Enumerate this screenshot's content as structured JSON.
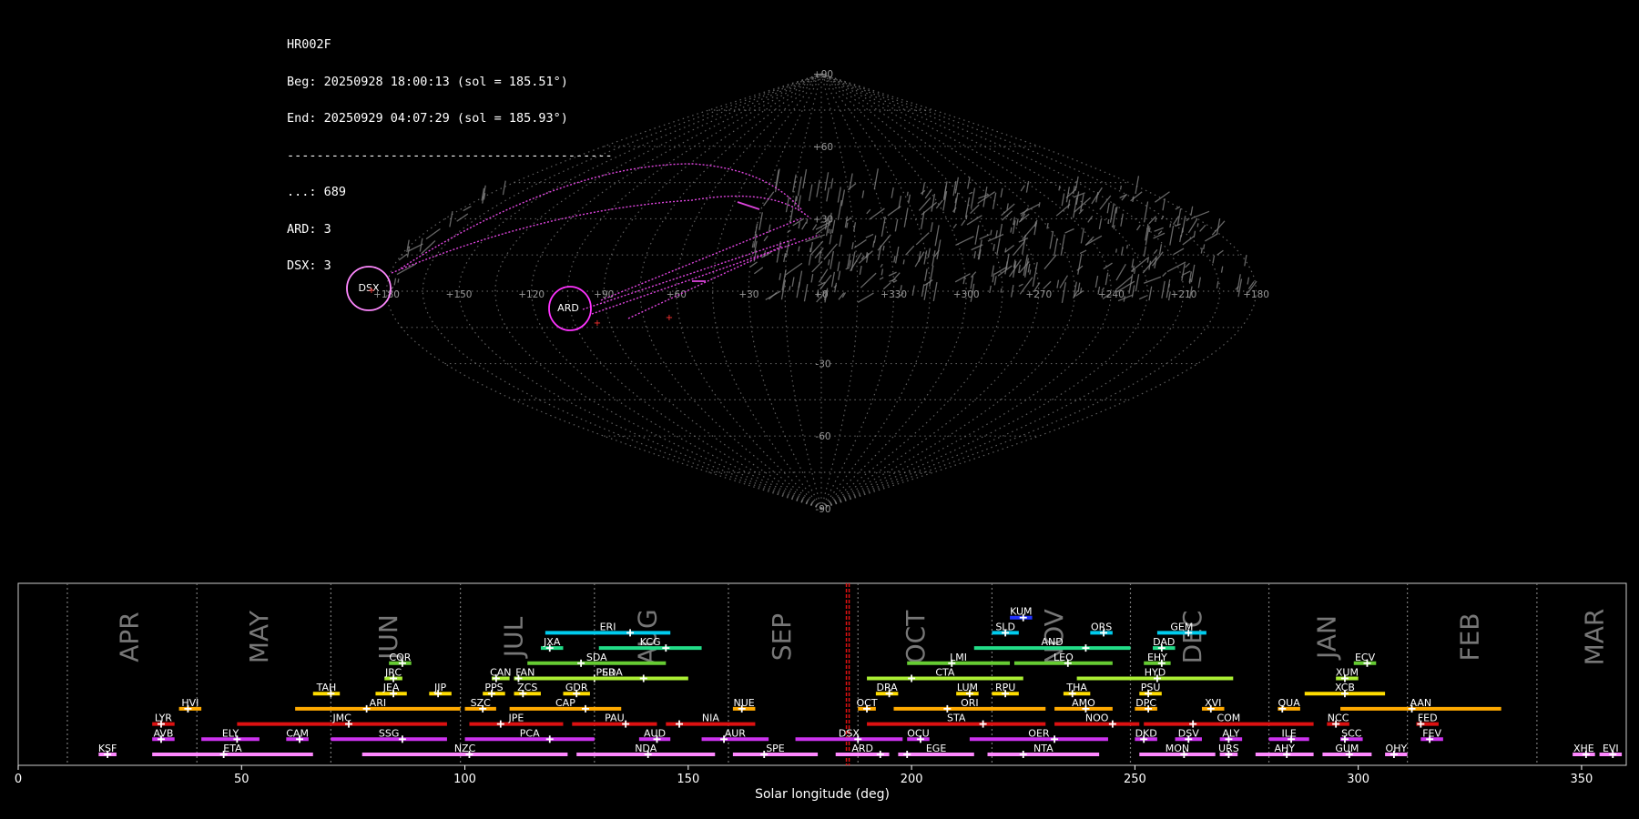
{
  "info": {
    "station": "HR002F",
    "beg": "Beg: 20250928 18:00:13 (sol = 185.51°)",
    "end": "End: 20250929 04:07:29 (sol = 185.93°)",
    "rule": "--------------------------------------------",
    "count_sporadic": "...: 689",
    "count_ard": "ARD: 3",
    "count_dsx": "DSX: 3"
  },
  "sky_map": {
    "projection": "sinusoidal",
    "lon_ticks": [
      "+180",
      "+150",
      "+120",
      "+90",
      "+60",
      "+30",
      "+0",
      "+330",
      "+300",
      "+270",
      "+240",
      "+210",
      "+180"
    ],
    "lat_ticks": [
      "+90",
      "+60",
      "+30",
      "-30",
      "-60",
      "-90"
    ],
    "radiants": [
      {
        "name": "DSX",
        "ring_color": "#ff88ff"
      },
      {
        "name": "ARD",
        "ring_color": "#ff33ff"
      }
    ],
    "colors": {
      "grid": "#888888",
      "sporadic": "#888888",
      "shower_trail": "#dd44dd",
      "marker": "#ff3333"
    }
  },
  "chart_data": {
    "type": "timeline",
    "xlabel": "Solar longitude (deg)",
    "xlim": [
      0,
      360
    ],
    "x_ticks": [
      "0",
      "50",
      "100",
      "150",
      "200",
      "250",
      "300",
      "350"
    ],
    "current_sol": 185.72,
    "current_sol_color": "#dd1111",
    "months": [
      {
        "name": "APR",
        "sol": 25
      },
      {
        "name": "MAY",
        "sol": 54
      },
      {
        "name": "JUN",
        "sol": 83
      },
      {
        "name": "JUL",
        "sol": 111
      },
      {
        "name": "AUG",
        "sol": 141
      },
      {
        "name": "SEP",
        "sol": 171
      },
      {
        "name": "OCT",
        "sol": 201
      },
      {
        "name": "NOV",
        "sol": 232
      },
      {
        "name": "DEC",
        "sol": 263
      },
      {
        "name": "JAN",
        "sol": 293
      },
      {
        "name": "FEB",
        "sol": 325
      },
      {
        "name": "MAR",
        "sol": 353
      }
    ],
    "month_boundaries": [
      11,
      40,
      70,
      99,
      129,
      159,
      188,
      218,
      249,
      280,
      311,
      340
    ],
    "showers": [
      {
        "code": "KSF",
        "start": 18,
        "end": 22,
        "peak": 20,
        "row": 0,
        "color": "#ff88ff"
      },
      {
        "code": "ETA",
        "start": 30,
        "end": 66,
        "peak": 46,
        "row": 0,
        "color": "#ff88ff"
      },
      {
        "code": "NZC",
        "start": 77,
        "end": 123,
        "peak": 101,
        "row": 0,
        "color": "#ff88ff"
      },
      {
        "code": "NDA",
        "start": 125,
        "end": 156,
        "peak": 141,
        "row": 0,
        "color": "#ff88ff"
      },
      {
        "code": "SPE",
        "start": 160,
        "end": 179,
        "peak": 167,
        "row": 0,
        "color": "#ff88ff"
      },
      {
        "code": "ARD",
        "start": 183,
        "end": 195,
        "peak": 193,
        "row": 0,
        "color": "#ff88ff"
      },
      {
        "code": "EGE",
        "start": 197,
        "end": 214,
        "peak": 199,
        "row": 0,
        "color": "#ff88ff"
      },
      {
        "code": "NTA",
        "start": 217,
        "end": 242,
        "peak": 225,
        "row": 0,
        "color": "#ff88ff"
      },
      {
        "code": "MON",
        "start": 251,
        "end": 268,
        "peak": 261,
        "row": 0,
        "color": "#ff88ff"
      },
      {
        "code": "URS",
        "start": 269,
        "end": 273,
        "peak": 271,
        "row": 0,
        "color": "#ff88ff"
      },
      {
        "code": "AHY",
        "start": 277,
        "end": 290,
        "peak": 284,
        "row": 0,
        "color": "#ff88ff"
      },
      {
        "code": "GUM",
        "start": 292,
        "end": 303,
        "peak": 298,
        "row": 0,
        "color": "#ff88ff"
      },
      {
        "code": "OHY",
        "start": 306,
        "end": 311,
        "peak": 308,
        "row": 0,
        "color": "#ff88ff"
      },
      {
        "code": "XHE",
        "start": 348,
        "end": 353,
        "peak": 351,
        "row": 0,
        "color": "#ff88ff"
      },
      {
        "code": "EVI",
        "start": 354,
        "end": 359,
        "peak": 357,
        "row": 0,
        "color": "#ff88ff"
      },
      {
        "code": "AVB",
        "start": 30,
        "end": 35,
        "peak": 32,
        "row": 1,
        "color": "#cc33ee"
      },
      {
        "code": "ELY",
        "start": 41,
        "end": 54,
        "peak": 49,
        "row": 1,
        "color": "#cc33ee"
      },
      {
        "code": "CAM",
        "start": 60,
        "end": 65,
        "peak": 63,
        "row": 1,
        "color": "#cc33ee"
      },
      {
        "code": "SSG",
        "start": 70,
        "end": 96,
        "peak": 86,
        "row": 1,
        "color": "#cc33ee"
      },
      {
        "code": "PCA",
        "start": 100,
        "end": 129,
        "peak": 119,
        "row": 1,
        "color": "#cc33ee"
      },
      {
        "code": "AUD",
        "start": 139,
        "end": 146,
        "peak": 143,
        "row": 1,
        "color": "#cc33ee"
      },
      {
        "code": "AUR",
        "start": 153,
        "end": 168,
        "peak": 158,
        "row": 1,
        "color": "#cc33ee"
      },
      {
        "code": "DSX",
        "start": 174,
        "end": 198,
        "peak": 188,
        "row": 1,
        "color": "#cc33ee"
      },
      {
        "code": "OCU",
        "start": 199,
        "end": 204,
        "peak": 202,
        "row": 1,
        "color": "#cc33ee"
      },
      {
        "code": "OER",
        "start": 213,
        "end": 244,
        "peak": 232,
        "row": 1,
        "color": "#cc33ee"
      },
      {
        "code": "DKD",
        "start": 250,
        "end": 255,
        "peak": 252,
        "row": 1,
        "color": "#cc33ee"
      },
      {
        "code": "DSV",
        "start": 259,
        "end": 265,
        "peak": 262,
        "row": 1,
        "color": "#cc33ee"
      },
      {
        "code": "ALY",
        "start": 269,
        "end": 274,
        "peak": 271,
        "row": 1,
        "color": "#cc33ee"
      },
      {
        "code": "ILE",
        "start": 280,
        "end": 289,
        "peak": 285,
        "row": 1,
        "color": "#cc33ee"
      },
      {
        "code": "SCC",
        "start": 296,
        "end": 301,
        "peak": 297,
        "row": 1,
        "color": "#cc33ee"
      },
      {
        "code": "FEV",
        "start": 314,
        "end": 319,
        "peak": 316,
        "row": 1,
        "color": "#cc33ee"
      },
      {
        "code": "LYR",
        "start": 30,
        "end": 35,
        "peak": 32,
        "row": 2,
        "color": "#dd1111"
      },
      {
        "code": "JMC",
        "start": 49,
        "end": 96,
        "peak": 74,
        "row": 2,
        "color": "#dd1111"
      },
      {
        "code": "JPE",
        "start": 101,
        "end": 122,
        "peak": 108,
        "row": 2,
        "color": "#dd1111"
      },
      {
        "code": "PAU",
        "start": 124,
        "end": 143,
        "peak": 136,
        "row": 2,
        "color": "#dd1111"
      },
      {
        "code": "NIA",
        "start": 145,
        "end": 165,
        "peak": 148,
        "row": 2,
        "color": "#dd1111"
      },
      {
        "code": "STA",
        "start": 190,
        "end": 230,
        "peak": 216,
        "row": 2,
        "color": "#dd1111"
      },
      {
        "code": "NOO",
        "start": 232,
        "end": 251,
        "peak": 245,
        "row": 2,
        "color": "#dd1111"
      },
      {
        "code": "COM",
        "start": 252,
        "end": 290,
        "peak": 263,
        "row": 2,
        "color": "#dd1111"
      },
      {
        "code": "NCC",
        "start": 293,
        "end": 298,
        "peak": 295,
        "row": 2,
        "color": "#dd1111"
      },
      {
        "code": "FED",
        "start": 313,
        "end": 318,
        "peak": 314,
        "row": 2,
        "color": "#dd1111"
      },
      {
        "code": "HVI",
        "start": 36,
        "end": 41,
        "peak": 38,
        "row": 3,
        "color": "#ffaa00"
      },
      {
        "code": "ARI",
        "start": 62,
        "end": 99,
        "peak": 78,
        "row": 3,
        "color": "#ffaa00"
      },
      {
        "code": "SZC",
        "start": 100,
        "end": 107,
        "peak": 104,
        "row": 3,
        "color": "#ffaa00"
      },
      {
        "code": "CAP",
        "start": 110,
        "end": 135,
        "peak": 127,
        "row": 3,
        "color": "#ffaa00"
      },
      {
        "code": "NUE",
        "start": 160,
        "end": 165,
        "peak": 162,
        "row": 3,
        "color": "#ffaa00"
      },
      {
        "code": "OCT",
        "start": 188,
        "end": 192,
        "peak": 190,
        "row": 3,
        "color": "#ffaa00"
      },
      {
        "code": "ORI",
        "start": 196,
        "end": 230,
        "peak": 208,
        "row": 3,
        "color": "#ffaa00"
      },
      {
        "code": "AMO",
        "start": 232,
        "end": 245,
        "peak": 239,
        "row": 3,
        "color": "#ffaa00"
      },
      {
        "code": "DPC",
        "start": 250,
        "end": 255,
        "peak": 253,
        "row": 3,
        "color": "#ffaa00"
      },
      {
        "code": "XVI",
        "start": 265,
        "end": 270,
        "peak": 267,
        "row": 3,
        "color": "#ffaa00"
      },
      {
        "code": "QUA",
        "start": 282,
        "end": 287,
        "peak": 283,
        "row": 3,
        "color": "#ffaa00"
      },
      {
        "code": "AAN",
        "start": 296,
        "end": 332,
        "peak": 312,
        "row": 3,
        "color": "#ffaa00"
      },
      {
        "code": "TAH",
        "start": 66,
        "end": 72,
        "peak": 70,
        "row": 4,
        "color": "#ffdd00"
      },
      {
        "code": "JEA",
        "start": 80,
        "end": 87,
        "peak": 84,
        "row": 4,
        "color": "#ffdd00"
      },
      {
        "code": "JIP",
        "start": 92,
        "end": 97,
        "peak": 94,
        "row": 4,
        "color": "#ffdd00"
      },
      {
        "code": "PPS",
        "start": 104,
        "end": 109,
        "peak": 106,
        "row": 4,
        "color": "#ffdd00"
      },
      {
        "code": "ZCS",
        "start": 111,
        "end": 117,
        "peak": 113,
        "row": 4,
        "color": "#ffdd00"
      },
      {
        "code": "GDR",
        "start": 122,
        "end": 128,
        "peak": 125,
        "row": 4,
        "color": "#ffdd00"
      },
      {
        "code": "DRA",
        "start": 192,
        "end": 197,
        "peak": 195,
        "row": 4,
        "color": "#ffdd00"
      },
      {
        "code": "LUM",
        "start": 210,
        "end": 215,
        "peak": 213,
        "row": 4,
        "color": "#ffdd00"
      },
      {
        "code": "RPU",
        "start": 218,
        "end": 224,
        "peak": 221,
        "row": 4,
        "color": "#ffdd00"
      },
      {
        "code": "THA",
        "start": 234,
        "end": 240,
        "peak": 236,
        "row": 4,
        "color": "#ffdd00"
      },
      {
        "code": "PSU",
        "start": 251,
        "end": 256,
        "peak": 253,
        "row": 4,
        "color": "#ffdd00"
      },
      {
        "code": "XCB",
        "start": 288,
        "end": 306,
        "peak": 297,
        "row": 4,
        "color": "#ffdd00"
      },
      {
        "code": "JRC",
        "start": 82,
        "end": 86,
        "peak": 84,
        "row": 5,
        "color": "#aaee33"
      },
      {
        "code": "CAN",
        "start": 106,
        "end": 110,
        "peak": 107,
        "row": 5,
        "color": "#aaee33"
      },
      {
        "code": "FAN",
        "start": 111,
        "end": 116,
        "peak": 112,
        "row": 5,
        "color": "#aaee33"
      },
      {
        "code": "SDA",
        "start": 116,
        "end": 150,
        "peak": 129,
        "row": 5,
        "color": "#aaee33"
      },
      {
        "code": "PER",
        "start": 116,
        "end": 147,
        "peak": 140,
        "row": 5,
        "color": "#aaee33"
      },
      {
        "code": "CTA",
        "start": 190,
        "end": 225,
        "peak": 200,
        "row": 5,
        "color": "#aaee33"
      },
      {
        "code": "HYD",
        "start": 237,
        "end": 272,
        "peak": 255,
        "row": 5,
        "color": "#aaee33"
      },
      {
        "code": "XUM",
        "start": 295,
        "end": 300,
        "peak": 297,
        "row": 5,
        "color": "#aaee33"
      },
      {
        "code": "COR",
        "start": 83,
        "end": 88,
        "peak": 86,
        "row": 6,
        "color": "#66cc33"
      },
      {
        "code": "SDA",
        "start": 114,
        "end": 145,
        "peak": 126,
        "row": 6,
        "color": "#66cc33"
      },
      {
        "code": "LMI",
        "start": 199,
        "end": 222,
        "peak": 209,
        "row": 6,
        "color": "#66cc33"
      },
      {
        "code": "LEO",
        "start": 223,
        "end": 245,
        "peak": 235,
        "row": 6,
        "color": "#66cc33"
      },
      {
        "code": "EHY",
        "start": 252,
        "end": 258,
        "peak": 256,
        "row": 6,
        "color": "#66cc33"
      },
      {
        "code": "ECV",
        "start": 299,
        "end": 304,
        "peak": 302,
        "row": 6,
        "color": "#66cc33"
      },
      {
        "code": "JXA",
        "start": 117,
        "end": 122,
        "peak": 119,
        "row": 7,
        "color": "#22dd88"
      },
      {
        "code": "KCG",
        "start": 130,
        "end": 153,
        "peak": 145,
        "row": 7,
        "color": "#22dd88"
      },
      {
        "code": "AND",
        "start": 214,
        "end": 249,
        "peak": 239,
        "row": 7,
        "color": "#22dd88"
      },
      {
        "code": "DAD",
        "start": 254,
        "end": 259,
        "peak": 256,
        "row": 7,
        "color": "#22dd88"
      },
      {
        "code": "ERI",
        "start": 118,
        "end": 146,
        "peak": 137,
        "row": 8,
        "color": "#00ccee"
      },
      {
        "code": "SLD",
        "start": 218,
        "end": 224,
        "peak": 221,
        "row": 8,
        "color": "#00ccee"
      },
      {
        "code": "ORS",
        "start": 240,
        "end": 245,
        "peak": 243,
        "row": 8,
        "color": "#00ccee"
      },
      {
        "code": "GEM",
        "start": 255,
        "end": 266,
        "peak": 262,
        "row": 8,
        "color": "#00ccee"
      },
      {
        "code": "KUM",
        "start": 222,
        "end": 227,
        "peak": 225,
        "row": 9,
        "color": "#2233ff"
      }
    ]
  }
}
